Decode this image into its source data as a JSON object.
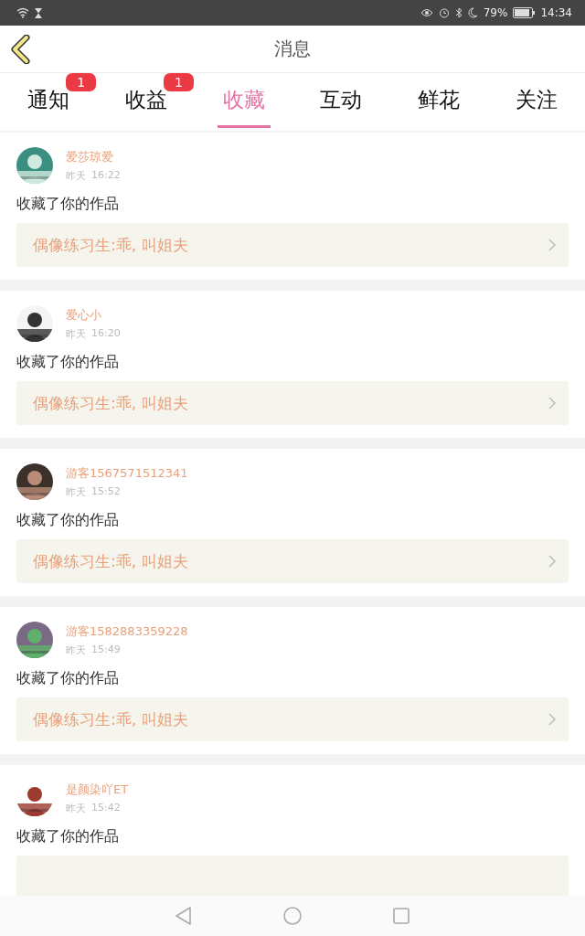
{
  "status_bar": {
    "battery_percent": "79%",
    "time": "14:34"
  },
  "header": {
    "title": "消息"
  },
  "tabs": [
    {
      "label": "通知",
      "selected": false,
      "badge": "1"
    },
    {
      "label": "收益",
      "selected": false,
      "badge": "1"
    },
    {
      "label": "收藏",
      "selected": true
    },
    {
      "label": "互动",
      "selected": false
    },
    {
      "label": "鲜花",
      "selected": false
    },
    {
      "label": "关注",
      "selected": false
    }
  ],
  "messages": [
    {
      "user": "爱莎琼爱",
      "date": "昨天",
      "time": "16:22",
      "text": "收藏了你的作品",
      "work": "偶像练习生:乖, 叫姐夫"
    },
    {
      "user": "爱心小",
      "date": "昨天",
      "time": "16:20",
      "text": "收藏了你的作品",
      "work": "偶像练习生:乖, 叫姐夫"
    },
    {
      "user": "游客1567571512341",
      "date": "昨天",
      "time": "15:52",
      "text": "收藏了你的作品",
      "work": "偶像练习生:乖, 叫姐夫"
    },
    {
      "user": "游客1582883359228",
      "date": "昨天",
      "time": "15:49",
      "text": "收藏了你的作品",
      "work": "偶像练习生:乖, 叫姐夫"
    },
    {
      "user": "是颜染吖ET",
      "date": "昨天",
      "time": "15:42",
      "text": "收藏了你的作品"
    }
  ]
}
